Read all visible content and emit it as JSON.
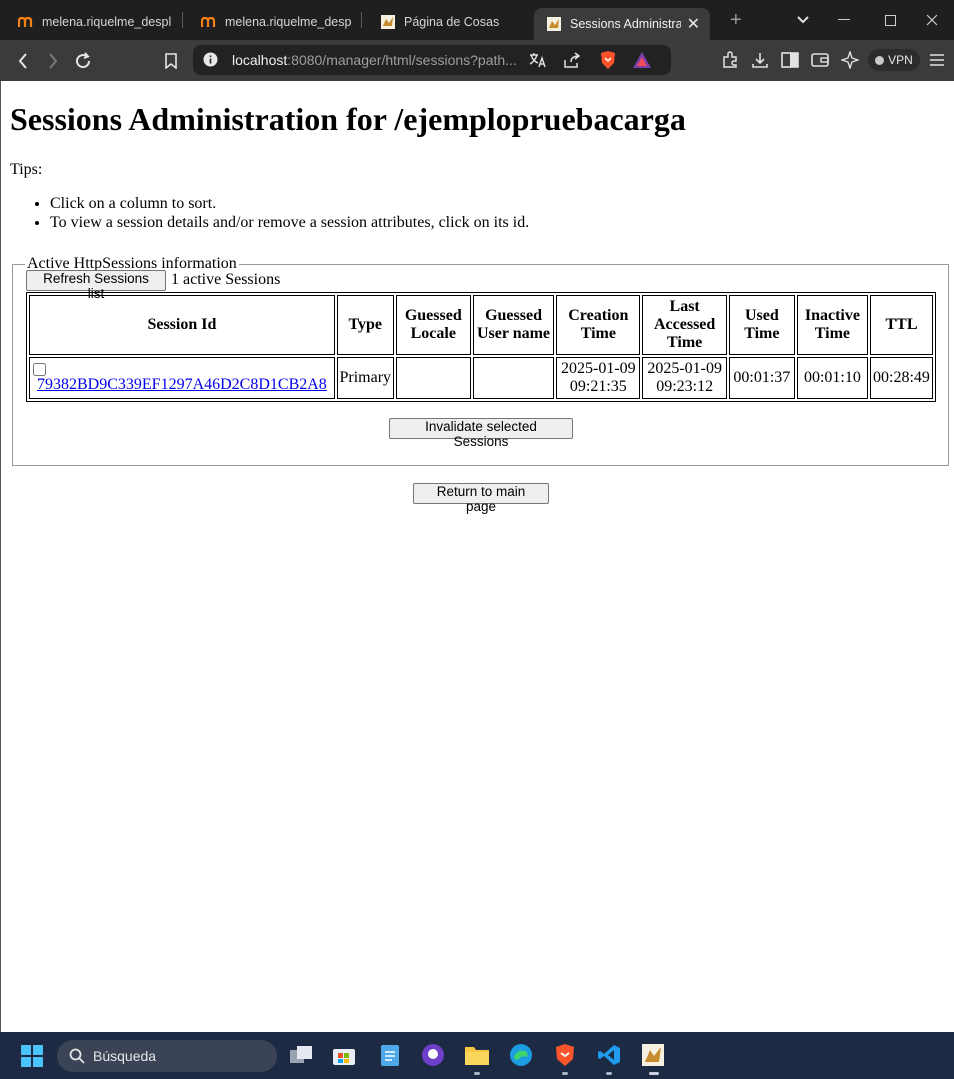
{
  "browser": {
    "tabs": [
      {
        "label": "melena.riquelme_desplie",
        "icon": "moodle-icon"
      },
      {
        "label": "melena.riquelme_desplie",
        "icon": "moodle-icon"
      },
      {
        "label": "Página de Cosas",
        "icon": "tomcat-icon"
      },
      {
        "label": "Sessions Administra",
        "icon": "tomcat-icon",
        "active": true
      }
    ],
    "url_host": "localhost",
    "url_rest": ":8080/manager/html/sessions?path...",
    "vpn_label": "VPN"
  },
  "page": {
    "heading": "Sessions Administration for /ejemplopruebacarga",
    "tips_label": "Tips:",
    "tips": [
      "Click on a column to sort.",
      "To view a session details and/or remove a session attributes, click on its id."
    ],
    "fieldset_legend": "Active HttpSessions information",
    "refresh_button": "Refresh Sessions list",
    "active_count": "1 active Sessions",
    "table": {
      "headers": [
        "Session Id",
        "Type",
        "Guessed Locale",
        "Guessed User name",
        "Creation Time",
        "Last Accessed Time",
        "Used Time",
        "Inactive Time",
        "TTL"
      ],
      "rows": [
        {
          "session_id": "79382BD9C339EF1297A46D2C8D1CB2A8",
          "type": "Primary",
          "guessed_locale": "",
          "guessed_user": "",
          "creation_date": "2025-01-09",
          "creation_time": "09:21:35",
          "last_accessed_date": "2025-01-09",
          "last_accessed_time": "09:23:12",
          "used_time": "00:01:37",
          "inactive_time": "00:01:10",
          "ttl": "00:28:49",
          "selected": false
        }
      ]
    },
    "invalidate_button": "Invalidate selected Sessions",
    "return_button": "Return to main page"
  },
  "taskbar": {
    "search_placeholder": "Búsqueda"
  }
}
